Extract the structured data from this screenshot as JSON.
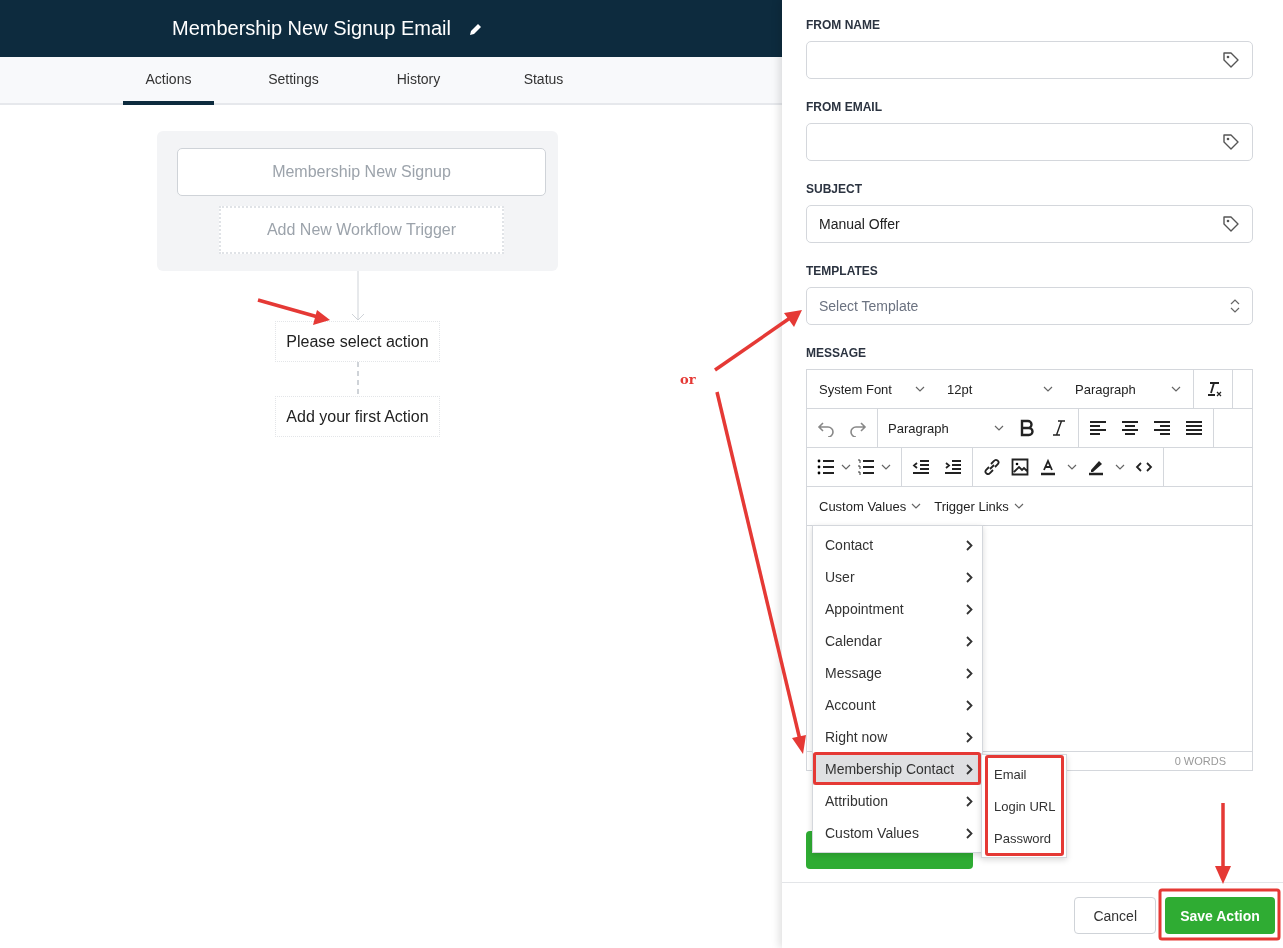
{
  "header": {
    "title": "Membership New Signup Email"
  },
  "tabs": [
    {
      "label": "Actions",
      "selected": true
    },
    {
      "label": "Settings",
      "selected": false
    },
    {
      "label": "History",
      "selected": false
    },
    {
      "label": "Status",
      "selected": false
    }
  ],
  "workflow": {
    "trigger": "Membership New Signup",
    "add_trigger": "Add New Workflow Trigger",
    "action_prompt": "Please select action",
    "add_action": "Add your first Action"
  },
  "form": {
    "fields": [
      {
        "label": "FROM NAME",
        "kind": "tag"
      },
      {
        "label": "FROM EMAIL",
        "kind": "tag"
      },
      {
        "label": "SUBJECT",
        "kind": "tag",
        "value": "Manual Offer"
      },
      {
        "label": "TEMPLATES",
        "kind": "select",
        "placeholder": "Select Template"
      }
    ],
    "message_label": "MESSAGE"
  },
  "editor": {
    "font": "System Font",
    "size": "12pt",
    "format": "Paragraph",
    "block": "Paragraph",
    "menus": [
      "Custom Values",
      "Trigger Links"
    ],
    "word_count": "0 WORDS"
  },
  "custom_values_menu": [
    {
      "label": "Contact",
      "selected": false
    },
    {
      "label": "User",
      "selected": false
    },
    {
      "label": "Appointment",
      "selected": false
    },
    {
      "label": "Calendar",
      "selected": false
    },
    {
      "label": "Message",
      "selected": false
    },
    {
      "label": "Account",
      "selected": false
    },
    {
      "label": "Right now",
      "selected": false
    },
    {
      "label": "Membership Contact",
      "selected": true
    },
    {
      "label": "Attribution",
      "selected": false
    },
    {
      "label": "Custom Values",
      "selected": false
    }
  ],
  "submenu": [
    "Email",
    "Login URL",
    "Password"
  ],
  "footer": {
    "buttons": [
      {
        "label": "Cancel",
        "kind": "secondary"
      },
      {
        "label": "Save Action",
        "kind": "primary"
      }
    ]
  },
  "annotations": {
    "note": "or"
  }
}
